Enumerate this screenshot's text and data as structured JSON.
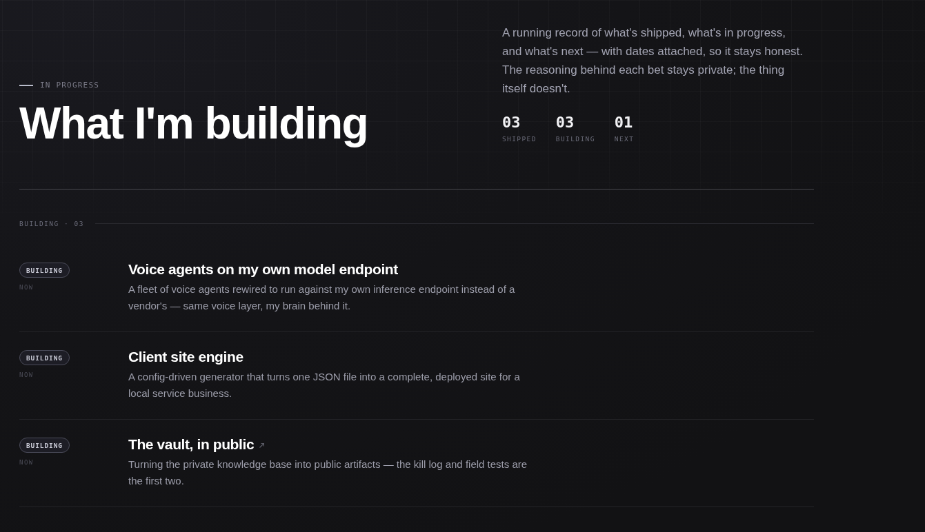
{
  "hero": {
    "eyebrow": "IN PROGRESS",
    "title": "What I'm building",
    "intro": "A running record of what's shipped, what's in progress, and what's next — with dates attached, so it stays honest. The reasoning behind each bet stays private; the thing itself doesn't.",
    "stats": [
      {
        "value": "03",
        "label": "SHIPPED"
      },
      {
        "value": "03",
        "label": "BUILDING"
      },
      {
        "value": "01",
        "label": "NEXT"
      }
    ]
  },
  "section": {
    "label": "BUILDING · 03",
    "items": [
      {
        "status": "BUILDING",
        "when": "NOW",
        "title": "Voice agents on my own model endpoint",
        "description": "A fleet of voice agents rewired to run against my own inference endpoint instead of a vendor's — same voice layer, my brain behind it.",
        "external": false
      },
      {
        "status": "BUILDING",
        "when": "NOW",
        "title": "Client site engine",
        "description": "A config-driven generator that turns one JSON file into a complete, deployed site for a local service business.",
        "external": false
      },
      {
        "status": "BUILDING",
        "when": "NOW",
        "title": "The vault, in public",
        "description": "Turning the private knowledge base into public artifacts — the kill log and field tests are the first two.",
        "external": true
      }
    ]
  }
}
